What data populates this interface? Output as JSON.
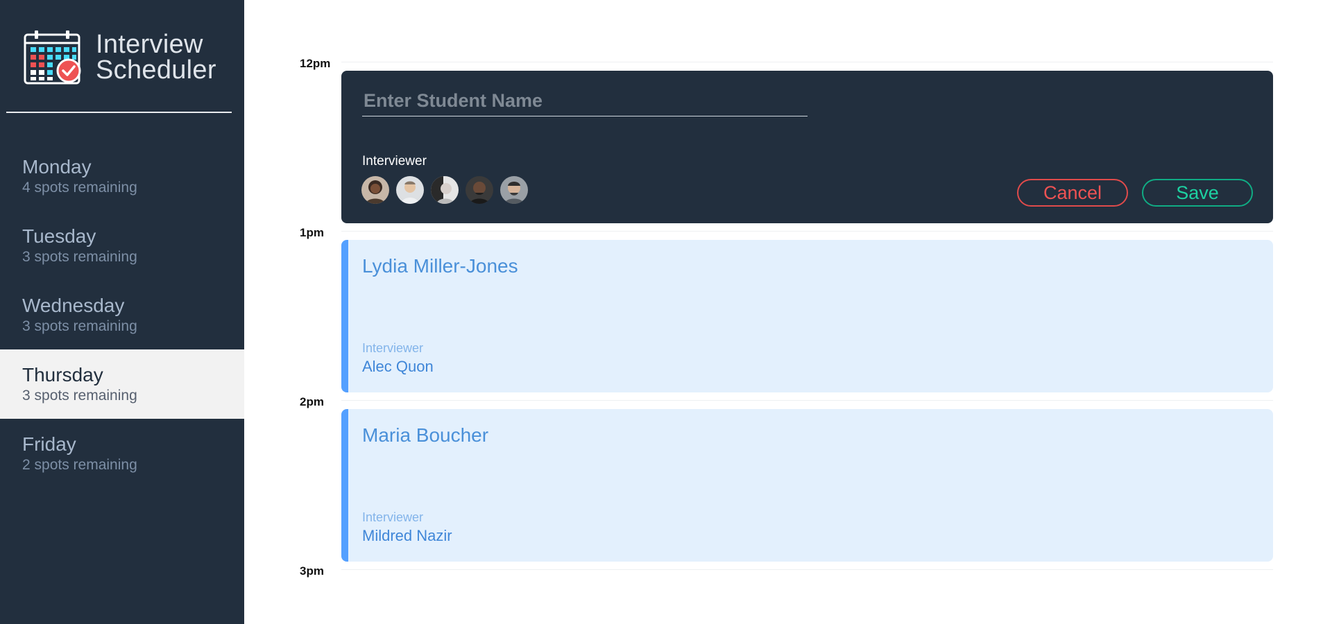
{
  "app": {
    "title_line1": "Interview",
    "title_line2": "Scheduler"
  },
  "sidebar": {
    "days": [
      {
        "name": "Monday",
        "spots": "4 spots remaining",
        "selected": false
      },
      {
        "name": "Tuesday",
        "spots": "3 spots remaining",
        "selected": false
      },
      {
        "name": "Wednesday",
        "spots": "3 spots remaining",
        "selected": false
      },
      {
        "name": "Thursday",
        "spots": "3 spots remaining",
        "selected": true
      },
      {
        "name": "Friday",
        "spots": "2 spots remaining",
        "selected": false
      }
    ]
  },
  "schedule": {
    "times": [
      "12pm",
      "1pm",
      "2pm",
      "3pm"
    ],
    "form": {
      "student_placeholder": "Enter Student Name",
      "student_value": "",
      "interviewer_label": "Interviewer",
      "avatars": [
        "interviewer-avatar-1",
        "interviewer-avatar-2",
        "interviewer-avatar-3",
        "interviewer-avatar-4",
        "interviewer-avatar-5"
      ],
      "cancel_label": "Cancel",
      "save_label": "Save"
    },
    "appointments": [
      {
        "student": "Lydia Miller-Jones",
        "interviewer_label": "Interviewer",
        "interviewer": "Alec Quon"
      },
      {
        "student": "Maria Boucher",
        "interviewer_label": "Interviewer",
        "interviewer": "Mildred Nazir"
      }
    ]
  },
  "colors": {
    "sidebar_bg": "#222f3e",
    "selected_day_bg": "#f2f2f2",
    "appointment_bg": "#e3f0fd",
    "appointment_accent": "#54a0ff",
    "cancel": "#ee5253",
    "save": "#1dd1a1"
  }
}
